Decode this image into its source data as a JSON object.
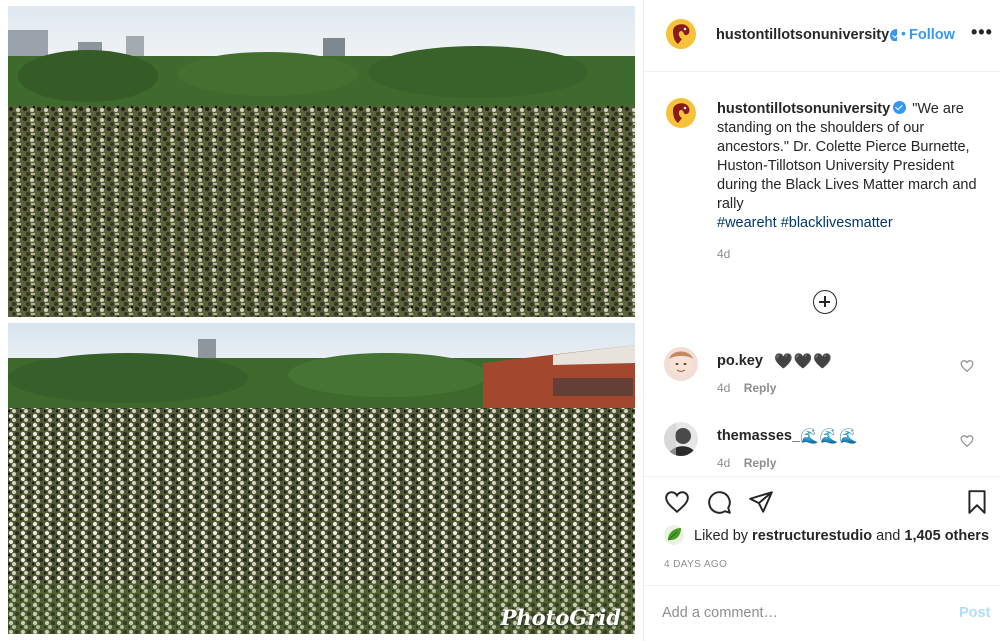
{
  "media": {
    "watermark": "PhotoGrid"
  },
  "header": {
    "username": "hustontillotsonuniversity",
    "separator": "•",
    "follow_label": "Follow",
    "more_label": "•••"
  },
  "caption": {
    "username": "hustontillotsonuniversity",
    "text": "\"We are standing on the shoulders of our ancestors.\" Dr. Colette Pierce Burnette, Huston-Tillotson University President during the Black Lives Matter march and rally",
    "hashtags": [
      "#weareht",
      "#blacklivesmatter"
    ],
    "time": "4d"
  },
  "comments": [
    {
      "username": "po.key",
      "text": "🖤🖤🖤",
      "time": "4d",
      "reply_label": "Reply"
    },
    {
      "username": "themasses_",
      "text": "🌊🌊🌊",
      "time": "4d",
      "reply_label": "Reply"
    }
  ],
  "likes": {
    "prefix": "Liked by",
    "user": "restructurestudio",
    "conjunction": "and",
    "others": "1,405 others"
  },
  "post_date": "4 DAYS AGO",
  "comment_box": {
    "placeholder": "Add a comment…",
    "post_label": "Post"
  },
  "colors": {
    "accent": "#3897f0",
    "hashtag": "#00376b",
    "muted": "#8e8e8e"
  }
}
